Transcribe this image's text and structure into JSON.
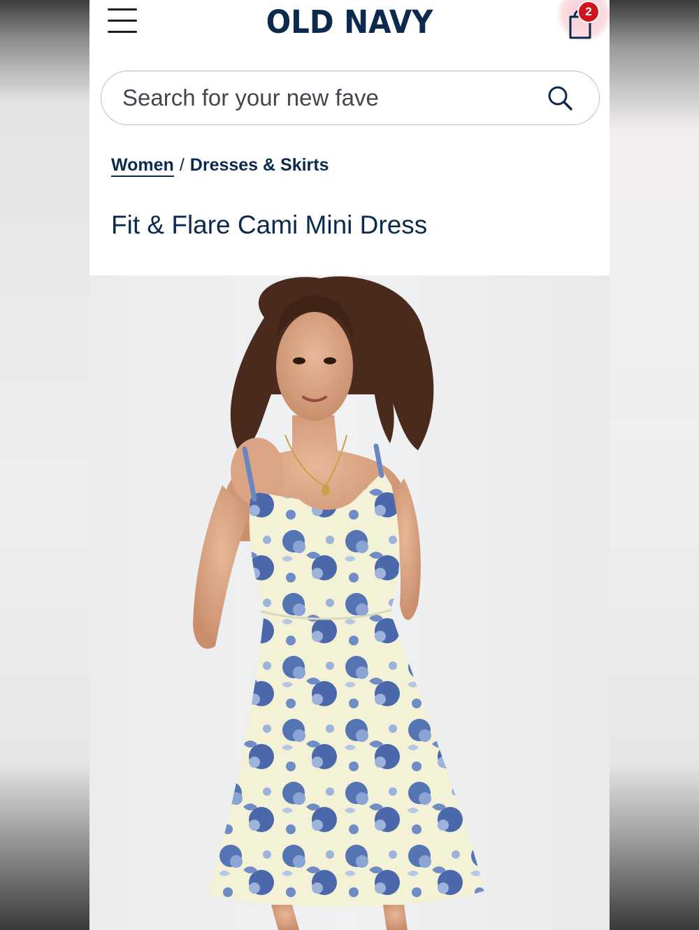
{
  "header": {
    "logo_text": "OLD NAVY",
    "menu_icon": "hamburger-menu-icon",
    "bag_icon": "shopping-bag-icon",
    "bag_count": "2"
  },
  "search": {
    "placeholder": "Search for your new fave",
    "icon": "search-icon"
  },
  "breadcrumb": {
    "items": [
      {
        "label": "Women"
      },
      {
        "label": "Dresses & Skirts"
      }
    ],
    "separator": "/"
  },
  "product": {
    "title": "Fit & Flare Cami Mini Dress",
    "image_alt": "Model wearing blue floral fit and flare cami mini dress"
  },
  "colors": {
    "brand_navy": "#0b2a4e",
    "badge_red": "#d0141e",
    "dress_base": "#f3f1d6",
    "dress_floral": "#4f6fb0"
  }
}
